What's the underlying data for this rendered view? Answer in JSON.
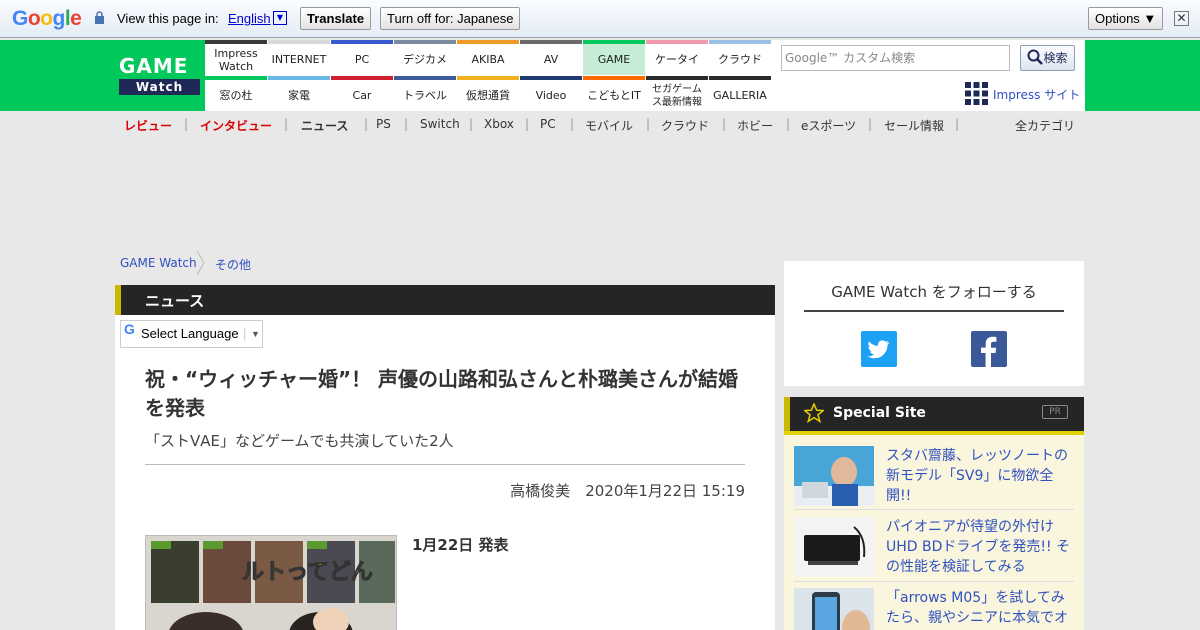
{
  "translate_bar": {
    "logo_text": "Google",
    "view_text": "View this page in:",
    "language": "English",
    "translate_label": "Translate",
    "turn_off_label": "Turn off for: Japanese",
    "options_label": "Options ▼",
    "close_label": "✕"
  },
  "header": {
    "logo_top": "GAME",
    "logo_bottom": "Watch",
    "tabs_top": [
      "Impress Watch",
      "INTERNET",
      "PC",
      "デジカメ",
      "AKIBA",
      "AV",
      "GAME",
      "ケータイ",
      "クラウド"
    ],
    "tabs_bottom": [
      "窓の杜",
      "家電",
      "Car",
      "トラベル",
      "仮想通貨",
      "Video",
      "こどもとIT",
      "セガゲームス最新情報",
      "GALLERIA"
    ],
    "search_placeholder": "Google™ カスタム検索",
    "search_button": "検索",
    "impress_site": "Impress サイト"
  },
  "category_nav": {
    "items": [
      "レビュー",
      "インタビュー",
      "ニュース",
      "PS",
      "Switch",
      "Xbox",
      "PC",
      "モバイル",
      "クラウド",
      "ホビー",
      "eスポーツ",
      "セール情報"
    ],
    "all_label": "全カテゴリ"
  },
  "breadcrumb": [
    "GAME Watch",
    "その他"
  ],
  "article": {
    "section": "ニュース",
    "select_language": "Select Language",
    "title": "祝・“ウィッチャー婚”！ 声優の山路和弘さんと朴璐美さんが結婚を発表",
    "subtitle": "「ストⅤAE」などゲームでも共演していた2人",
    "author": "高橋俊美",
    "datetime": "2020年1月22日 15:19",
    "date_label": "1月22日 発表",
    "thumb_caption": "ルトってどん"
  },
  "sidebar": {
    "follow_title": "GAME Watch をフォローする",
    "special_title": "Special Site",
    "pr_label": "PR",
    "items": [
      {
        "text": "スタバ齋藤、レッツノートの新モデル「SV9」に物欲全開!!"
      },
      {
        "text": "パイオニアが待望の外付けUHD BDドライブを発売!! その性能を検証してみる"
      },
      {
        "text": "「arrows M05」を試してみたら、親やシニアに本気でオ"
      }
    ]
  },
  "colors": {
    "brand_green": "#00c85a",
    "link_blue": "#3050c0",
    "accent_red": "#dd0000",
    "header_dark": "#252525",
    "accent_yellow": "#c9b800"
  }
}
